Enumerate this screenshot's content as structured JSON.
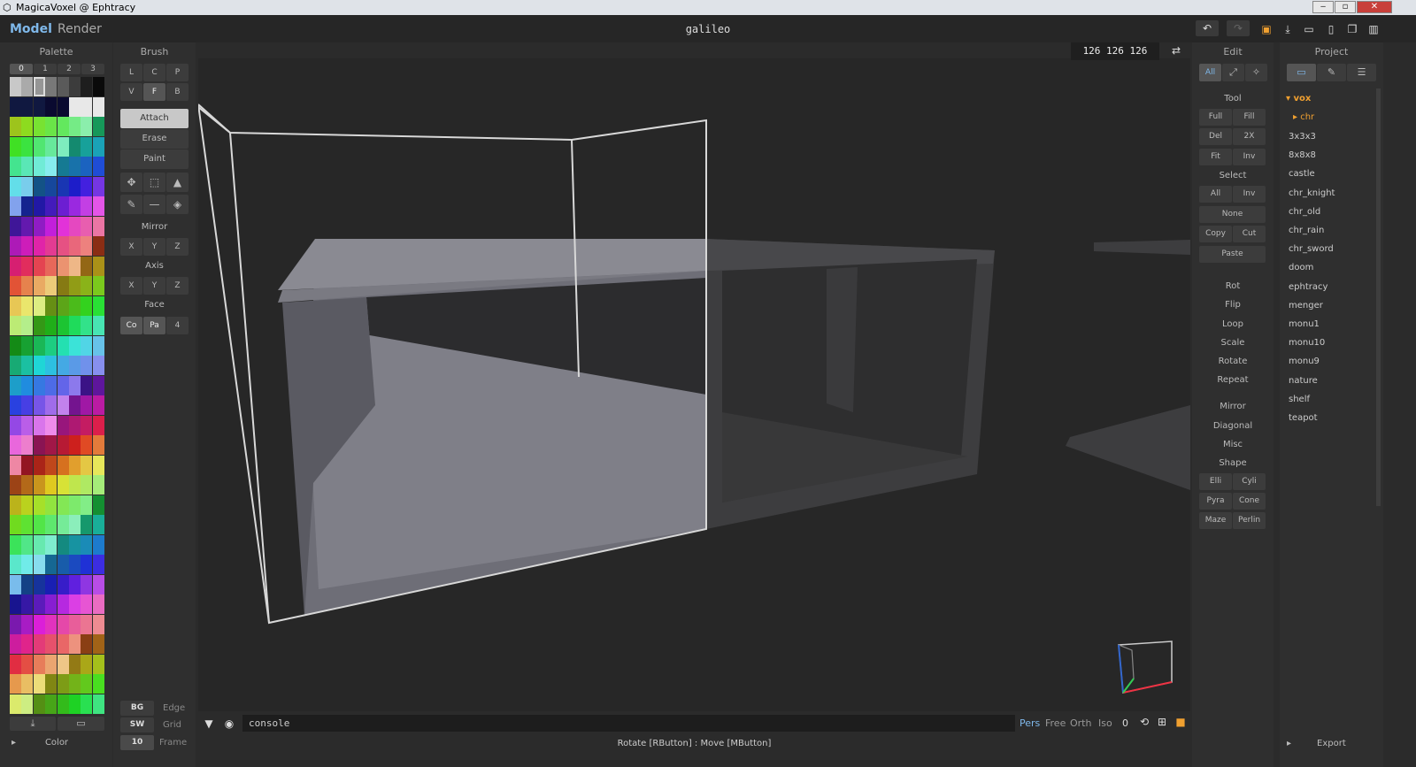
{
  "window": {
    "title": "MagicaVoxel @ Ephtracy"
  },
  "topbar": {
    "mode_model": "Model",
    "mode_render": "Render",
    "document": "galileo"
  },
  "viewport": {
    "coords": "126 126 126",
    "console_label": "console",
    "status": "Rotate [RButton] : Move [MButton]",
    "view_modes": [
      "Pers",
      "Free",
      "Orth",
      "Iso"
    ],
    "active_view": "Pers",
    "zoom_value": "0"
  },
  "palette": {
    "title": "Palette",
    "pages": [
      "0",
      "1",
      "2",
      "3"
    ],
    "color_label": "Color"
  },
  "brush": {
    "title": "Brush",
    "types_row1": [
      "L",
      "C",
      "P"
    ],
    "types_row2": [
      "V",
      "F",
      "B"
    ],
    "modes": [
      "Attach",
      "Erase",
      "Paint"
    ],
    "mirror_label": "Mirror",
    "mirror": [
      "X",
      "Y",
      "Z"
    ],
    "axis_label": "Axis",
    "axis": [
      "X",
      "Y",
      "Z"
    ],
    "face_label": "Face",
    "face": [
      "Co",
      "Pa",
      "4"
    ],
    "bg": "BG",
    "edge": "Edge",
    "sw": "SW",
    "grid": "Grid",
    "frame_value": "10",
    "frame": "Frame"
  },
  "edit": {
    "title": "Edit",
    "tab_all": "All",
    "tool_label": "Tool",
    "tool": [
      "Full",
      "Fill",
      "Del",
      "2X",
      "Fit",
      "Inv"
    ],
    "select_label": "Select",
    "select": [
      "All",
      "Inv"
    ],
    "select_none": "None",
    "copy": "Copy",
    "cut": "Cut",
    "paste": "Paste",
    "ops": [
      "Rot",
      "Flip",
      "Loop",
      "Scale",
      "Rotate",
      "Repeat"
    ],
    "ops2": [
      "Mirror",
      "Diagonal",
      "Misc",
      "Shape"
    ],
    "shape": [
      "Elli",
      "Cyli",
      "Pyra",
      "Cone",
      "Maze",
      "Perlin"
    ]
  },
  "project": {
    "title": "Project",
    "folder_vox": "vox",
    "folder_chr": "chr",
    "files": [
      "3x3x3",
      "8x8x8",
      "castle",
      "chr_knight",
      "chr_old",
      "chr_rain",
      "chr_sword",
      "doom",
      "ephtracy",
      "menger",
      "monu1",
      "monu10",
      "monu9",
      "nature",
      "shelf",
      "teapot"
    ],
    "export": "Export"
  },
  "colors": {
    "accent": "#7fb8ea",
    "folder": "#f0a030",
    "panel": "#2f2f2f",
    "viewport": "#272727"
  }
}
